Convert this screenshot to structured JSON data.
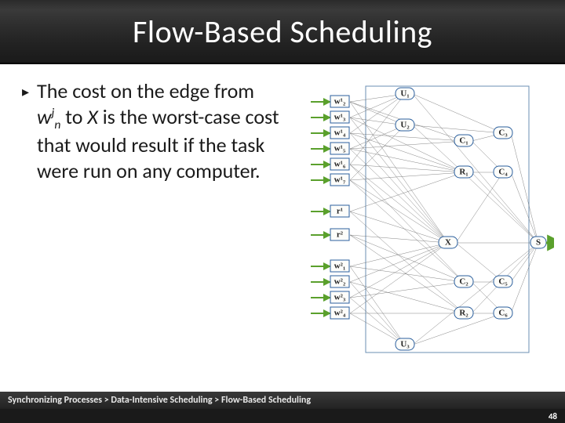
{
  "title": "Flow-Based Scheduling",
  "bullet": {
    "marker": "▸",
    "text_pre": "The cost on the edge from ",
    "var_w": "w",
    "var_sup": "j",
    "var_sub": "n",
    "text_mid": " to ",
    "var_x": "X",
    "text_post": " is the worst-case cost that would result if the task were run on any computer."
  },
  "figure": {
    "left_nodes_group1": [
      "w¹₂",
      "w¹₃",
      "w¹₄",
      "w¹₅",
      "w¹₆",
      "w¹₇"
    ],
    "left_nodes_r": [
      "r¹",
      "r²"
    ],
    "left_nodes_group2": [
      "w²₁",
      "w²₂",
      "w²₃",
      "w²₄"
    ],
    "top_nodes": [
      "U₁",
      "U₂"
    ],
    "mid_nodes_left": [
      "C₁",
      "R₁"
    ],
    "x_node": "X",
    "mid_nodes_right": [
      "C₂",
      "R₂"
    ],
    "right_nodes": [
      "C₃",
      "C₄",
      "C₅",
      "C₆"
    ],
    "bottom_node": "U₃",
    "sink": "S"
  },
  "breadcrumb": "Synchronizing Processes > Data-Intensive Scheduling > Flow-Based Scheduling",
  "page_number": "48"
}
